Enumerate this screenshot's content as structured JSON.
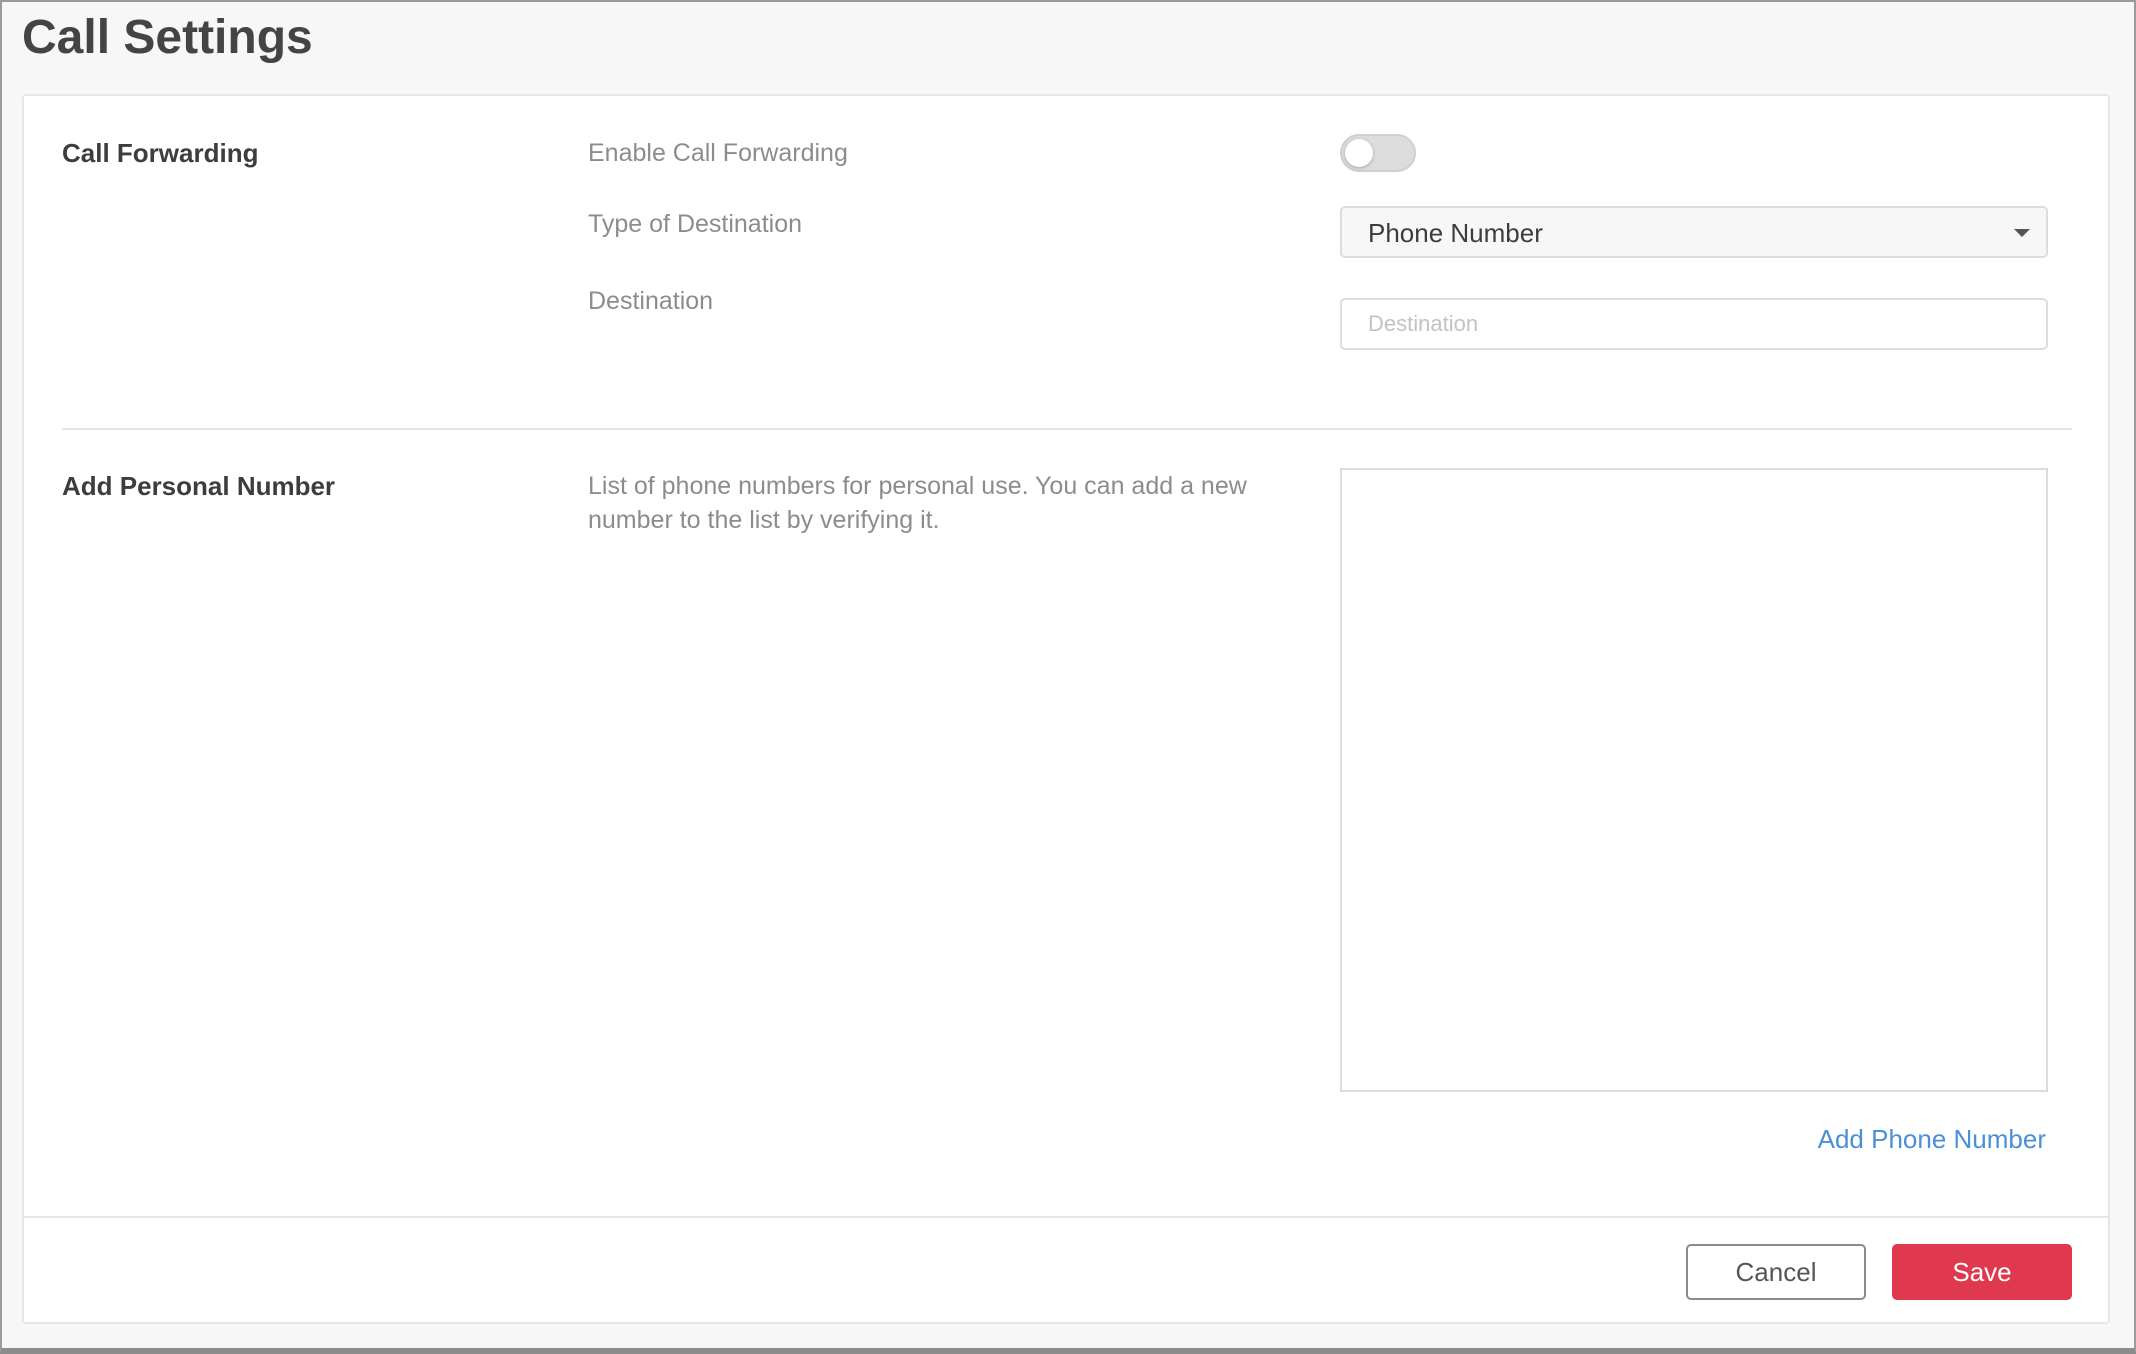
{
  "page": {
    "title": "Call Settings"
  },
  "call_forwarding": {
    "section_title": "Call Forwarding",
    "enable_label": "Enable Call Forwarding",
    "enabled": false,
    "type_label": "Type of Destination",
    "type_value": "Phone Number",
    "destination_label": "Destination",
    "destination_value": "",
    "destination_placeholder": "Destination"
  },
  "personal_number": {
    "section_title": "Add Personal Number",
    "description": "List of phone numbers for personal use. You can add a new number to the list by verifying it.",
    "numbers": [],
    "add_link": "Add Phone Number"
  },
  "footer": {
    "cancel_label": "Cancel",
    "save_label": "Save"
  },
  "colors": {
    "accent": "#e0384f",
    "link": "#4a90d9",
    "muted_text": "#8c8c8c"
  }
}
